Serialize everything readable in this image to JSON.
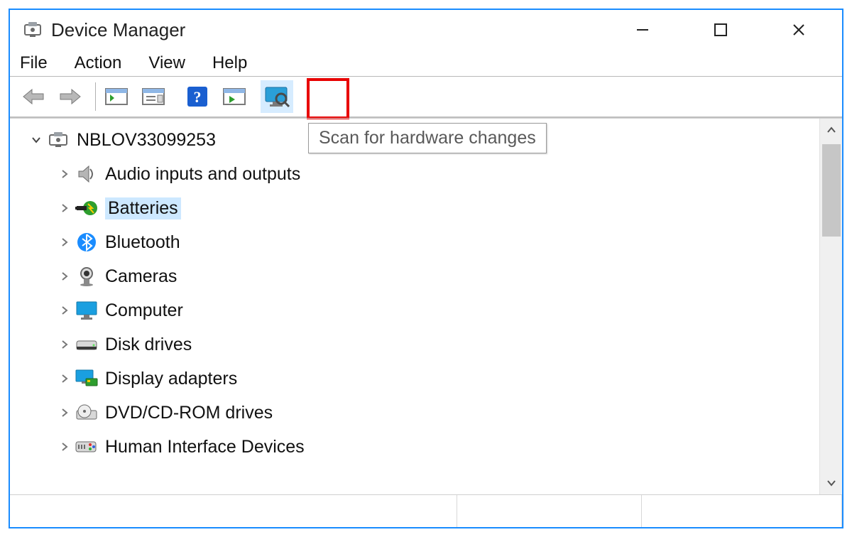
{
  "window": {
    "title": "Device Manager"
  },
  "menu": {
    "file": "File",
    "action": "Action",
    "view": "View",
    "help": "Help"
  },
  "tooltip": {
    "scan": "Scan for hardware changes"
  },
  "tree": {
    "root": "NBLOV33099253",
    "items": [
      "Audio inputs and outputs",
      "Batteries",
      "Bluetooth",
      "Cameras",
      "Computer",
      "Disk drives",
      "Display adapters",
      "DVD/CD-ROM drives",
      "Human Interface Devices"
    ],
    "selected_index": 1
  }
}
